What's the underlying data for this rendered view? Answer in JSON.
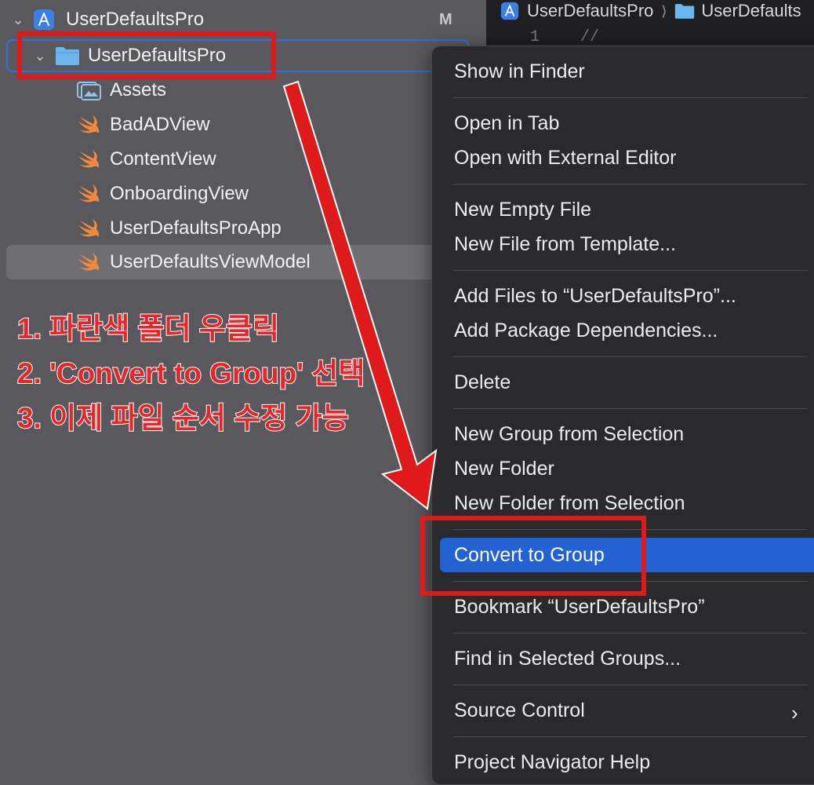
{
  "navigator": {
    "project_name": "UserDefaultsPro",
    "scm_badge": "M",
    "folder_name": "UserDefaultsPro",
    "files": [
      {
        "name": "Assets",
        "icon": "assets-catalog-icon"
      },
      {
        "name": "BadADView",
        "icon": "swift-file-icon"
      },
      {
        "name": "ContentView",
        "icon": "swift-file-icon"
      },
      {
        "name": "OnboardingView",
        "icon": "swift-file-icon"
      },
      {
        "name": "UserDefaultsProApp",
        "icon": "swift-file-icon"
      },
      {
        "name": "UserDefaultsViewModel",
        "icon": "swift-file-icon",
        "selected": true
      }
    ]
  },
  "editor": {
    "breadcrumb": [
      "UserDefaultsPro",
      "UserDefaults"
    ],
    "first_line_number": "1",
    "first_line_code": "//"
  },
  "context_menu": {
    "items": [
      "Show in Finder",
      "Open in Tab",
      "Open with External Editor",
      "New Empty File",
      "New File from Template...",
      "Add Files to “UserDefaultsPro”...",
      "Add Package Dependencies...",
      "Delete",
      "New Group from Selection",
      "New Folder",
      "New Folder from Selection",
      "Convert to Group",
      "Bookmark “UserDefaultsPro”",
      "Find in Selected Groups...",
      "Source Control",
      "Project Navigator Help"
    ],
    "highlighted": "Convert to Group",
    "submenu_item": "Source Control"
  },
  "annotation": {
    "lines": [
      "1. 파란색 폴더 우클릭",
      "2. 'Convert to Group' 선택",
      "3. 이제 파일 순서 수정 가능"
    ]
  },
  "colors": {
    "navigator_bg": "#59595d",
    "menu_bg": "#2a2a2d",
    "highlight": "#2462d3",
    "annotation_red": "#e0191a",
    "swift_orange": "#f0883e",
    "folder_blue": "#6cb6ef"
  }
}
